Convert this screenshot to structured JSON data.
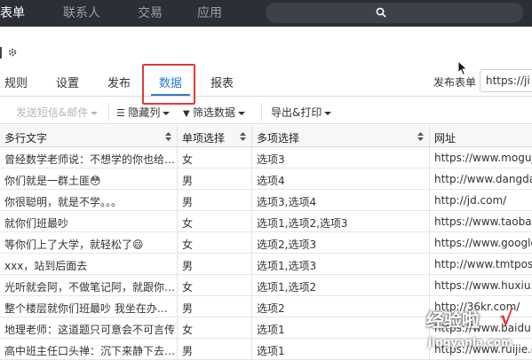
{
  "topnav": {
    "items": [
      {
        "label": "表单",
        "active": true
      },
      {
        "label": "联系人",
        "active": false
      },
      {
        "label": "交易",
        "active": false
      },
      {
        "label": "应用",
        "active": false
      }
    ]
  },
  "tabs": [
    {
      "label": "规则"
    },
    {
      "label": "设置"
    },
    {
      "label": "发布"
    },
    {
      "label": "数据",
      "active": true
    },
    {
      "label": "报表"
    }
  ],
  "publish": {
    "label": "发布表单",
    "url_value": "https://ji"
  },
  "toolbar": {
    "send_sms_email": "发送短信&邮件",
    "hide_columns": "隐藏列",
    "filter_data": "筛选数据",
    "export_print": "导出&打印"
  },
  "table": {
    "columns": [
      "多行文字",
      "单项选择",
      "多项选择",
      "网址"
    ],
    "rows": [
      [
        "曾经数学老师说：不想学的你也给…",
        "女",
        "选项3",
        "https://www.moguji"
      ],
      [
        "你们就是一群土匪😳",
        "男",
        "选项4",
        "http://www.dangdan"
      ],
      [
        "你很聪明，就是不学。。。",
        "男",
        "选项3,选项4",
        "http://jd.com/"
      ],
      [
        "就你们班最吵",
        "女",
        "选项1,选项2,选项3",
        "https://www.taobac"
      ],
      [
        "等你们上了大学，就轻松了😄",
        "女",
        "选项2,选项3",
        "https://www.google"
      ],
      [
        "xxx，站到后面去",
        "男",
        "选项1,选项3",
        "http://www.tmtpost"
      ],
      [
        "光听就会阿，不做笔记阿，就跟你…",
        "女",
        "选项1,选项2",
        "https://www.huxiu."
      ],
      [
        "整个楼层就你们班最吵 我坐在办…",
        "男",
        "选项2",
        "http://36kr.com/"
      ],
      [
        "地理老师：这道题只可意会不可言传",
        "女",
        "选项1",
        "https://www.baidu.co"
      ],
      [
        "高中班主任口头禅：沉下来静下去…",
        "男",
        "选项1",
        "https://www.ruijie.c"
      ]
    ]
  },
  "watermark": {
    "text": "经验啦",
    "check": "√",
    "sub": "jingyanla.com"
  },
  "colors": {
    "accent": "#2a7ad8",
    "highlight_box": "#e03b3b",
    "nav_bg": "#2b2f36"
  }
}
